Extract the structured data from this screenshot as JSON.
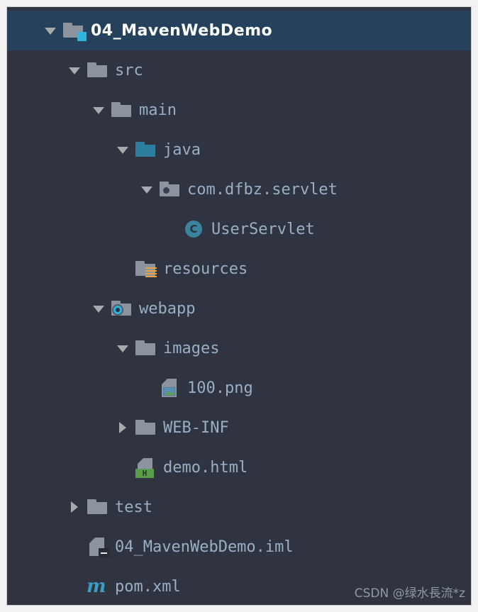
{
  "panel": {
    "background": "#2f3440",
    "selected_background": "#26415c",
    "text_color": "#9aaec6",
    "selected_text_color": "#ffffff",
    "accent_blue": "#2d7d9e",
    "badge_cyan": "#2fb4e0",
    "badge_orange": "#e8a33d",
    "badge_green": "#5a9e4b",
    "maven_blue": "#3b9cc4"
  },
  "tree": {
    "rows": [
      {
        "label": "04_MavenWebDemo",
        "indent": 1,
        "toggle": "down",
        "icon": "project-folder-icon",
        "selected": true
      },
      {
        "label": "src",
        "indent": 2,
        "toggle": "down",
        "icon": "folder-icon",
        "selected": false
      },
      {
        "label": "main",
        "indent": 3,
        "toggle": "down",
        "icon": "folder-icon",
        "selected": false
      },
      {
        "label": "java",
        "indent": 4,
        "toggle": "down",
        "icon": "source-folder-icon",
        "selected": false
      },
      {
        "label": "com.dfbz.servlet",
        "indent": 5,
        "toggle": "down",
        "icon": "package-icon",
        "selected": false
      },
      {
        "label": "UserServlet",
        "indent": 6,
        "toggle": "none",
        "icon": "java-class-icon",
        "selected": false
      },
      {
        "label": "resources",
        "indent": 4,
        "toggle": "none",
        "icon": "resources-folder-icon",
        "selected": false
      },
      {
        "label": "webapp",
        "indent": 3,
        "toggle": "down",
        "icon": "webapp-folder-icon",
        "selected": false
      },
      {
        "label": "images",
        "indent": 4,
        "toggle": "down",
        "icon": "folder-icon",
        "selected": false
      },
      {
        "label": "100.png",
        "indent": 5,
        "toggle": "none",
        "icon": "image-file-icon",
        "selected": false
      },
      {
        "label": "WEB-INF",
        "indent": 4,
        "toggle": "right",
        "icon": "folder-icon",
        "selected": false
      },
      {
        "label": "demo.html",
        "indent": 4,
        "toggle": "none",
        "icon": "html-file-icon",
        "selected": false
      },
      {
        "label": "test",
        "indent": 2,
        "toggle": "right",
        "icon": "folder-icon",
        "selected": false
      },
      {
        "label": "04_MavenWebDemo.iml",
        "indent": 2,
        "toggle": "none",
        "icon": "iml-file-icon",
        "selected": false
      },
      {
        "label": "pom.xml",
        "indent": 2,
        "toggle": "none",
        "icon": "maven-file-icon",
        "selected": false
      }
    ],
    "class_icon_letter": "C",
    "html_badge_letter": "H",
    "maven_icon_letter": "m"
  },
  "watermark": {
    "text": "CSDN @绿水長流*z"
  }
}
